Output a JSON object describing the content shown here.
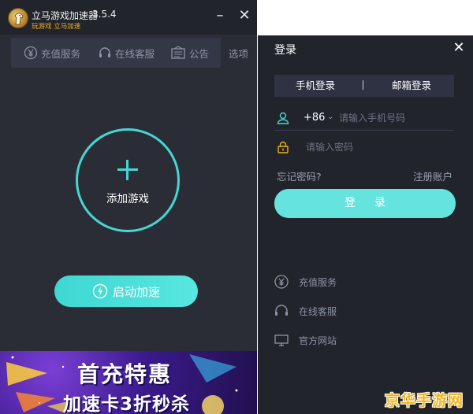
{
  "app": {
    "name": "立马游戏加速器",
    "version": "3.5.4",
    "slogan": "玩游戏  立马加速"
  },
  "nav": {
    "recharge": "充值服务",
    "service": "在线客服",
    "notice": "公告",
    "options": "选项"
  },
  "main": {
    "add_game_label": "添加游戏",
    "start_label": "启动加速"
  },
  "banner": {
    "line1": "首充特惠",
    "line2": "加速卡3折秒杀"
  },
  "login": {
    "title": "登录",
    "tabs": [
      "手机登录",
      "邮箱登录"
    ],
    "country_code": "+86",
    "phone_placeholder": "请输入手机号码",
    "password_placeholder": "请输入密码",
    "forgot": "忘记密码?",
    "register": "注册账户",
    "submit": "登录"
  },
  "footer_links": {
    "recharge": "充值服务",
    "service": "在线客服",
    "site": "官方网站"
  },
  "watermark": "京华手游网",
  "colors": {
    "accent": "#45d6d3",
    "window_bg": "#2b2d36",
    "panel_bg": "#22242c",
    "slogan": "#f0b21a",
    "watermark": "#f3b51a"
  }
}
